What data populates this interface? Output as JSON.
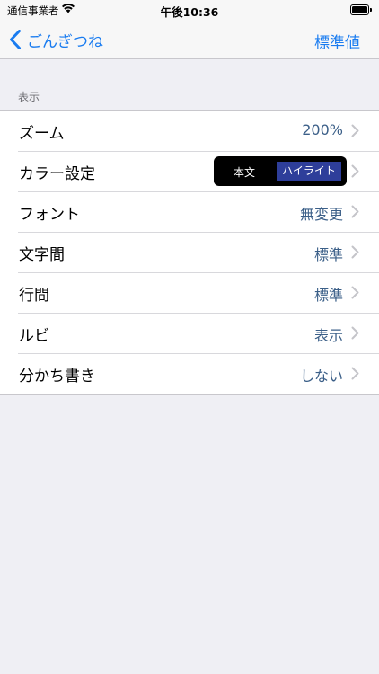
{
  "status": {
    "carrier": "通信事業者",
    "time": "午後10:36"
  },
  "nav": {
    "back_label": "ごんぎつね",
    "reset_label": "標準値"
  },
  "section": {
    "header": "表示"
  },
  "rows": [
    {
      "label": "ズーム",
      "value": "200%"
    },
    {
      "label": "カラー設定",
      "preview_body": "本文",
      "preview_highlight": "ハイライト"
    },
    {
      "label": "フォント",
      "value": "無変更"
    },
    {
      "label": "文字間",
      "value": "標準"
    },
    {
      "label": "行間",
      "value": "標準"
    },
    {
      "label": "ルビ",
      "value": "表示"
    },
    {
      "label": "分かち書き",
      "value": "しない"
    }
  ],
  "colors": {
    "accent": "#1a7cf0",
    "value_text": "#3b5f88",
    "preview_bg": "#000000",
    "highlight_bg": "#2e3e9a"
  }
}
